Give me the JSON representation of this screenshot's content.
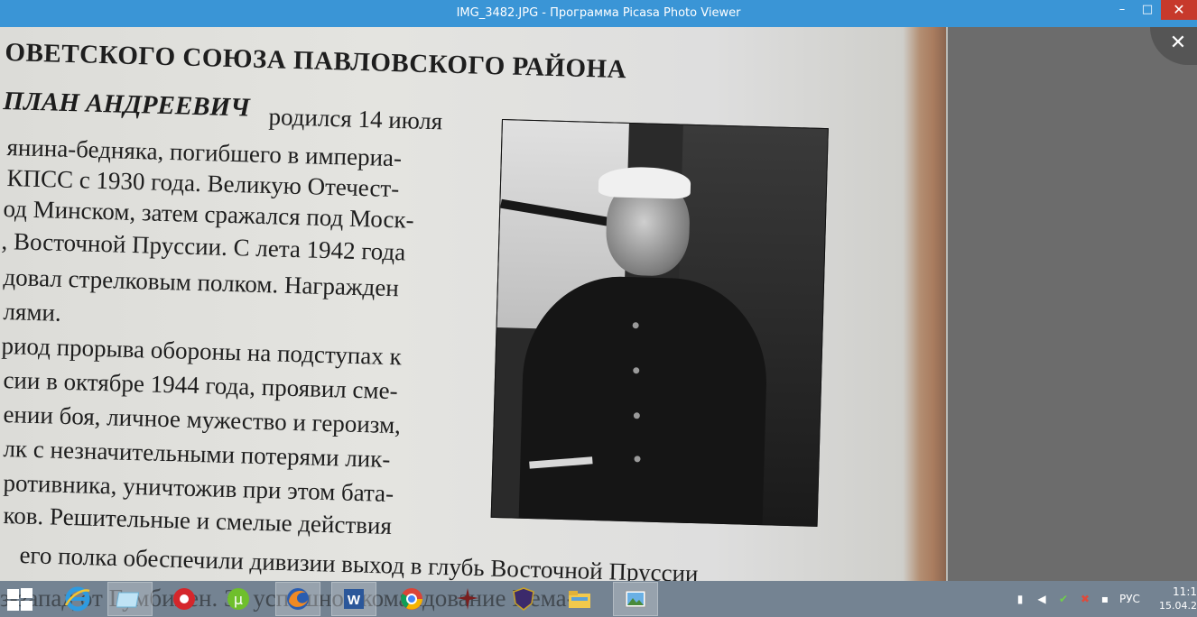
{
  "window": {
    "title": "IMG_3482.JPG - Программа Picasa Photo Viewer",
    "min_glyph": "–",
    "max_glyph": "□",
    "close_glyph": "✕"
  },
  "viewer": {
    "close_glyph": "✕"
  },
  "photo": {
    "heading": "ОВЕТСКОГО СОЮЗА ПАВЛОВСКОГО РАЙОНА",
    "name": "ПЛАН АНДРЕЕВИЧ",
    "lines": [
      "родился 14 июля",
      "янина-бедняка, погибшего в империа-",
      "КПСС с 1930 года. Великую Отечест-",
      "од Минском, затем сражался под Моск-",
      ", Восточной Пруссии. С лета 1942 года",
      "довал стрелковым полком. Награжден",
      "лями.",
      "риод прорыва обороны на подступах к",
      "сии в октябре 1944 года, проявил сме-",
      "ении боя, личное мужество и героизм,",
      "лк с незначительными потерями лик-",
      "ротивника, уничтожив при этом бата-",
      "ков. Решительные и смелые действия",
      "его полка обеспечили дивизии выход в глубь Восточной Пруссии",
      "з-запад от Гумбинен. За успешное командование Нема-"
    ]
  },
  "taskbar": {
    "apps": [
      "internet-explorer-icon",
      "folder-app-icon",
      "red-app-icon",
      "utorrent-icon",
      "firefox-icon",
      "word-icon",
      "chrome-icon",
      "game-icon",
      "shield-game-icon",
      "file-explorer-icon",
      "picasa-photo-viewer-icon"
    ],
    "word_letter": "W",
    "utorrent_letter": "μ",
    "tray": {
      "language": "РУС",
      "time": "11:1",
      "date": "15.04.2"
    }
  },
  "colors": {
    "titlebar": "#3a95d6",
    "close": "#c7392b",
    "taskbar": "#7a8ca0"
  }
}
